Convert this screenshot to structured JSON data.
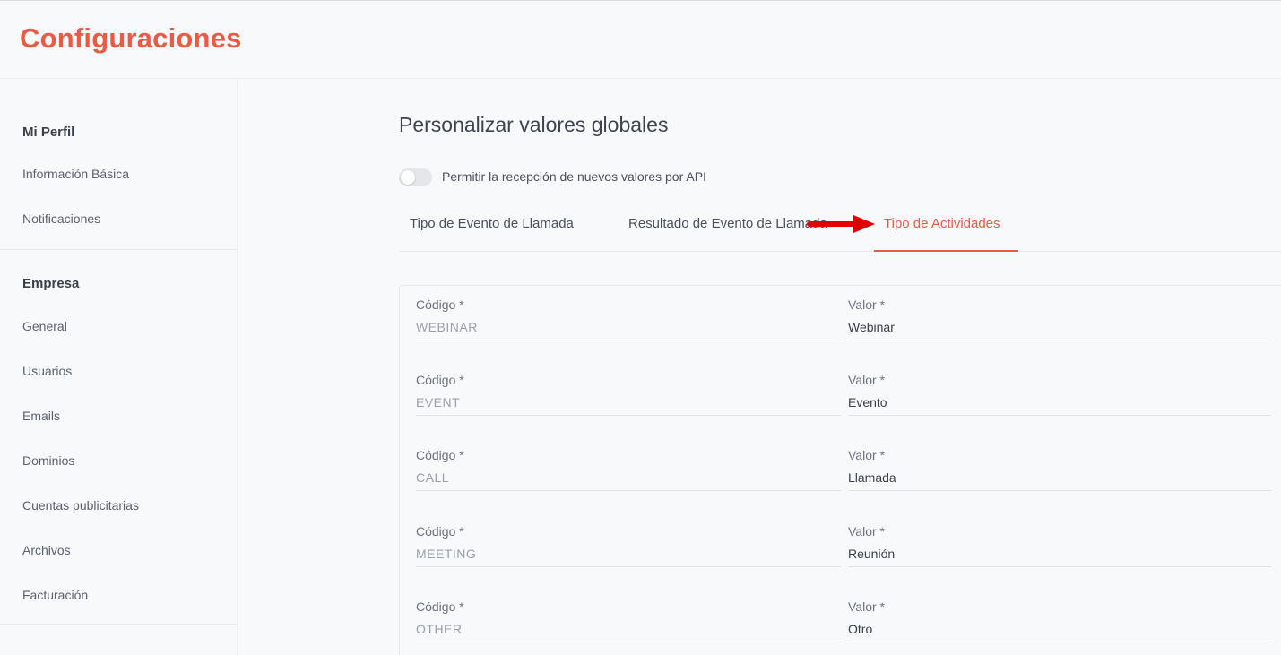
{
  "header": {
    "title": "Configuraciones"
  },
  "sidebar": {
    "sections": [
      {
        "title": "Mi Perfil",
        "items": [
          "Información Básica",
          "Notificaciones"
        ]
      },
      {
        "title": "Empresa",
        "items": [
          "General",
          "Usuarios",
          "Emails",
          "Dominios",
          "Cuentas publicitarias",
          "Archivos",
          "Facturación"
        ]
      }
    ]
  },
  "main": {
    "heading": "Personalizar valores globales",
    "toggle": {
      "label": "Permitir la recepción de nuevos valores por API",
      "enabled": false
    },
    "tabs": [
      {
        "label": "Tipo de Evento de Llamada",
        "active": false
      },
      {
        "label": "Resultado de Evento de Llamada",
        "active": false
      },
      {
        "label": "Tipo de Actividades",
        "active": true
      }
    ],
    "arrow_icon": "red-arrow-right",
    "accent_color": "#ea5b45",
    "field_labels": {
      "code": "Código *",
      "value": "Valor *"
    },
    "rows": [
      {
        "code": "WEBINAR",
        "value": "Webinar"
      },
      {
        "code": "EVENT",
        "value": "Evento"
      },
      {
        "code": "CALL",
        "value": "Llamada"
      },
      {
        "code": "MEETING",
        "value": "Reunión"
      },
      {
        "code": "OTHER",
        "value": "Otro"
      }
    ]
  }
}
